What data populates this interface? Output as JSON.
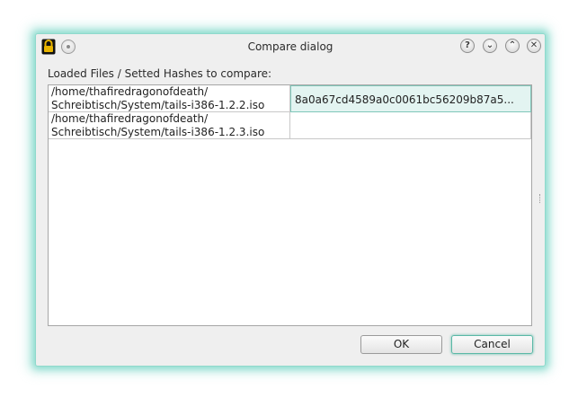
{
  "window": {
    "title": "Compare dialog"
  },
  "label": "Loaded Files / Setted Hashes to compare:",
  "rows": [
    {
      "path_line1": "/home/thafiredragonofdeath/",
      "path_line2": "Schreibtisch/System/tails-i386-1.2.2.iso",
      "hash": "8a0a67cd4589a0c0061bc56209b87a5..."
    },
    {
      "path_line1": "/home/thafiredragonofdeath/",
      "path_line2": "Schreibtisch/System/tails-i386-1.2.3.iso",
      "hash": ""
    }
  ],
  "buttons": {
    "ok": "OK",
    "cancel": "Cancel"
  },
  "titlebar_buttons": {
    "help": "?",
    "minimize": "⌄",
    "maximize": "⌃",
    "close": "✕"
  },
  "colors": {
    "accent": "#7fc7ba",
    "lock_icon": "#e8b400"
  }
}
